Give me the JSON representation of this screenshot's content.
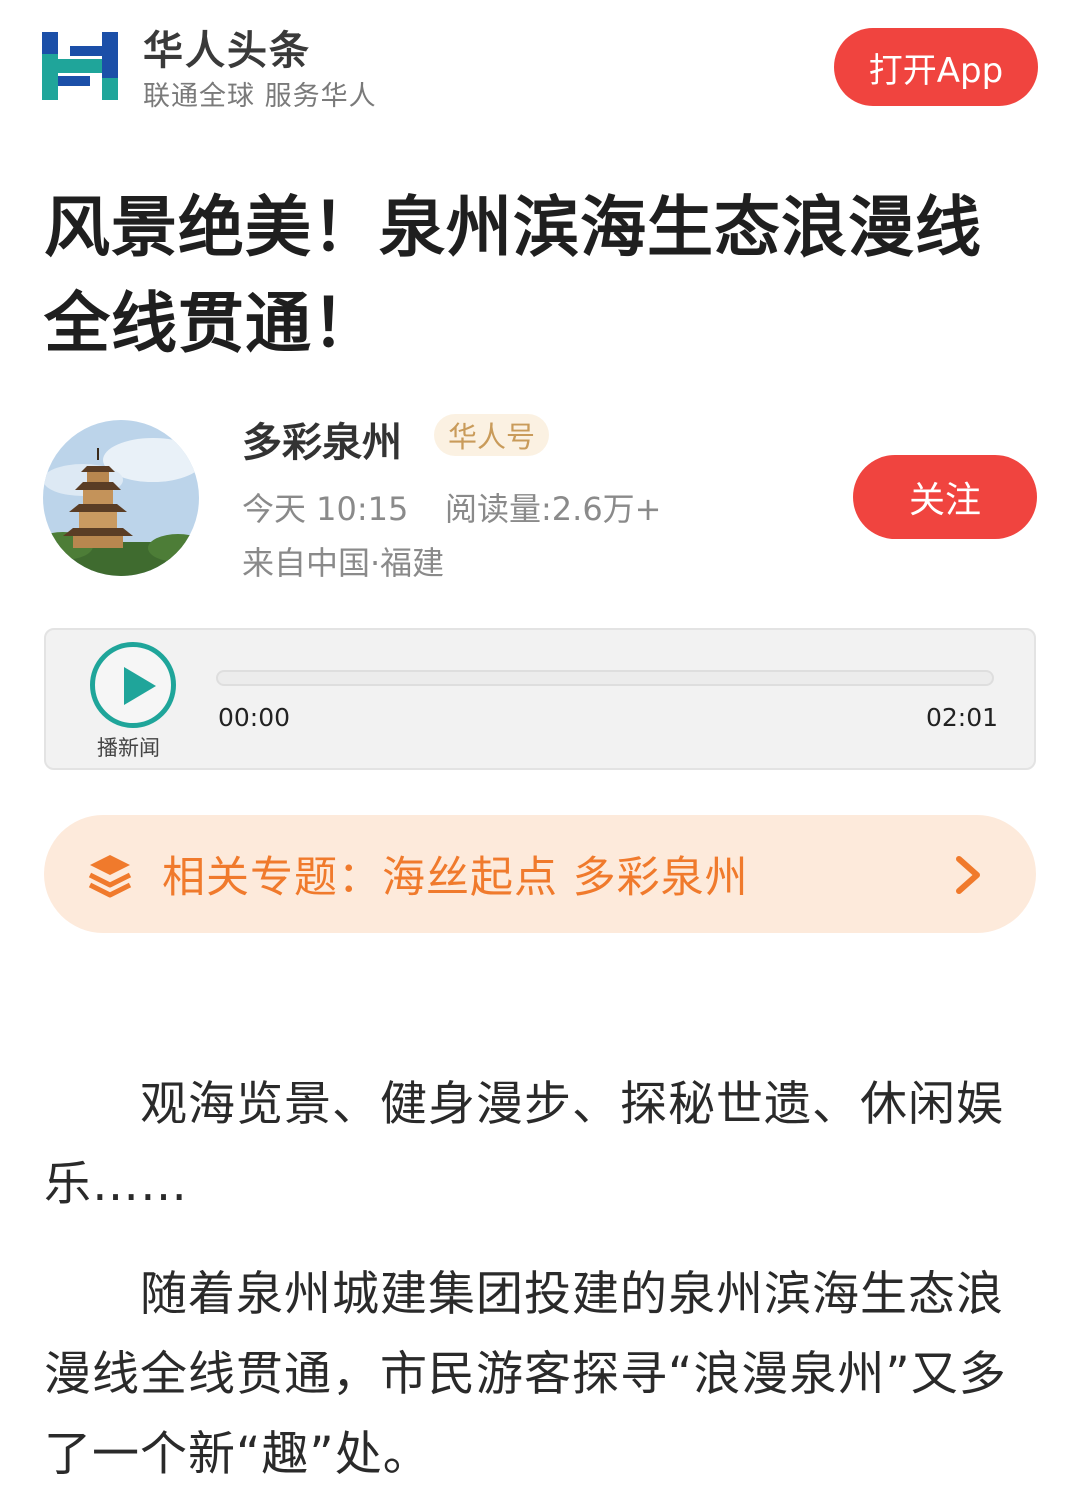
{
  "header": {
    "brand_name": "华人头条",
    "slogan": "联通全球 服务华人",
    "open_app_label": "打开App",
    "brand_colors": {
      "blue": "#1b4fa8",
      "teal": "#1fa59a"
    }
  },
  "article": {
    "title": "风景绝美！泉州滨海生态浪漫线全线贯通！",
    "author": {
      "name": "多彩泉州",
      "badge": "华人号",
      "time": "今天 10:15",
      "reads": "阅读量:2.6万+",
      "location": "来自中国·福建",
      "follow_label": "关注"
    },
    "audio": {
      "play_label": "播新闻",
      "current_time": "00:00",
      "total_time": "02:01",
      "progress": 0
    },
    "topic": {
      "icon": "layers-icon",
      "text": "相关专题：海丝起点 多彩泉州"
    },
    "paragraphs": [
      "观海览景、健身漫步、探秘世遗、休闲娱乐……",
      "随着泉州城建集团投建的泉州滨海生态浪漫线全线贯通，市民游客探寻“浪漫泉州”又多了一个新“趣”处。"
    ]
  },
  "colors": {
    "accent_red": "#f0443f",
    "topic_orange": "#f07a2c",
    "topic_bg": "#fdeadb",
    "play_teal": "#1fa59a",
    "badge_bg": "#fbf1e2",
    "badge_text": "#c99b5a"
  }
}
